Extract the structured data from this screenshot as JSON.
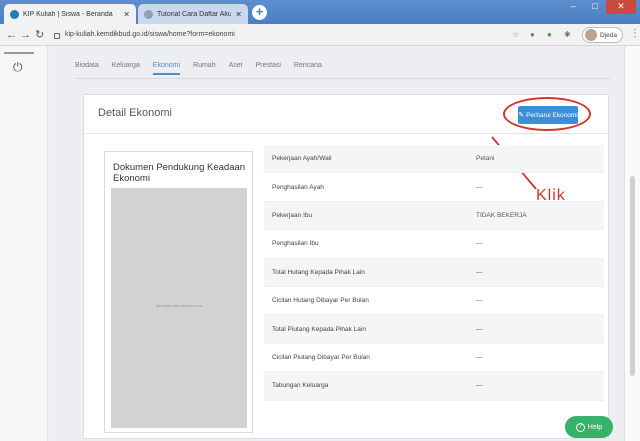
{
  "browser": {
    "tabs": [
      {
        "title": "KIP Kuliah | Siswa - Beranda",
        "active": true
      },
      {
        "title": "Tutorial Cara Daftar Akun KIP Ku",
        "active": false
      }
    ],
    "new_tab": "+",
    "url": "kip-kuliah.kemdikbud.go.id/siswa/home?form=ekonomi",
    "profile_name": "Djeda",
    "colors": {
      "tabstrip": "#4b7fc2",
      "close": "#c94a3f"
    }
  },
  "nav_tabs": [
    "Biodata",
    "Keluarga",
    "Ekonomi",
    "Rumah",
    "Aset",
    "Prestasi",
    "Rencana"
  ],
  "active_tab": "Ekonomi",
  "card": {
    "title": "Detail Ekonomi",
    "update_button": "Perbarui Ekonomi",
    "annotation": "Klik",
    "document": {
      "title": "Dokumen Pendukung Keadaan Ekonomi",
      "placeholder_caption": "dan takan tidak gambar boron"
    },
    "rows": [
      {
        "label": "Pekerjaan Ayah/Wali",
        "value": "Petani"
      },
      {
        "label": "Penghasilan Ayah",
        "value": "—"
      },
      {
        "label": "Pekerjaan Ibu",
        "value": "TIDAK BEKERJA"
      },
      {
        "label": "Penghasilan Ibu",
        "value": "—"
      },
      {
        "label": "Total Hutang Kepada Pihak Lain",
        "value": "—"
      },
      {
        "label": "Cicilan Hutang Dibayar Per Bulan",
        "value": "—"
      },
      {
        "label": "Total Piutang Kepada Pihak Lain",
        "value": "—"
      },
      {
        "label": "Cicilan Piutang Dibayar Per Bulan",
        "value": "—"
      },
      {
        "label": "Tabungan Keluarga",
        "value": "—"
      }
    ]
  },
  "help_label": "Help",
  "accent": "#3c8ed8",
  "help_color": "#35b36a",
  "annotation_color": "#d0352b"
}
